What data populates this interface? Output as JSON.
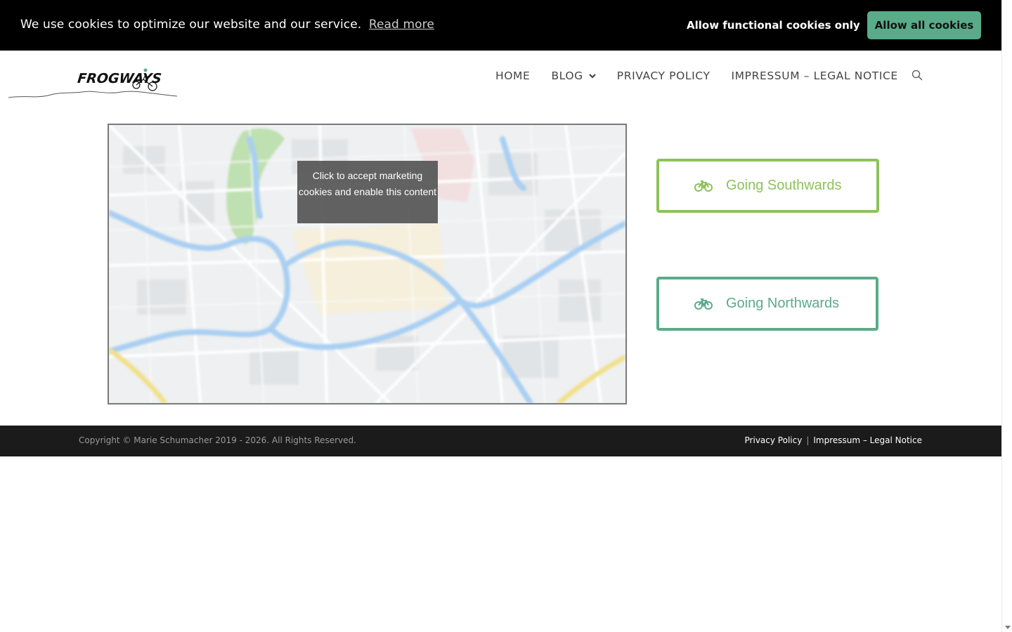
{
  "cookie_bar": {
    "message": "We use cookies to optimize our website and our service.",
    "read_more": "Read more",
    "functional_button": "Allow functional cookies only",
    "allow_all_button": "Allow all cookies"
  },
  "header": {
    "logo_text": "FROGWAYS",
    "nav": [
      {
        "label": "HOME"
      },
      {
        "label": "BLOG",
        "has_dropdown": true
      },
      {
        "label": "PRIVACY POLICY"
      },
      {
        "label": "IMPRESSUM – LEGAL NOTICE"
      }
    ],
    "search_icon": "search-icon"
  },
  "map": {
    "overlay_text": "Click to accept marketing cookies and enable this content"
  },
  "buttons": {
    "south": {
      "label": "Going Southwards",
      "icon": "bicycle-icon",
      "color": "#8dc25a"
    },
    "north": {
      "label": "Going Northwards",
      "icon": "bicycle-icon",
      "color": "#5aab8a"
    }
  },
  "footer": {
    "copyright": "Copyright © Marie Schumacher 2019 - 2026. All Rights Reserved.",
    "links": [
      "Privacy Policy",
      "Impressum – Legal Notice"
    ],
    "separator": "|"
  }
}
